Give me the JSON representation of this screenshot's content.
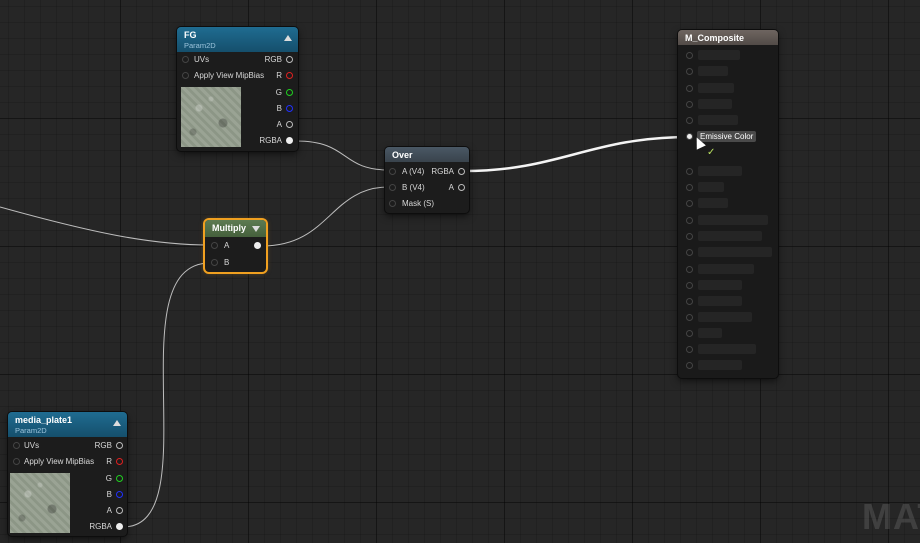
{
  "colors": {
    "param_header": "#1f6c91",
    "over_header": "#4a5865",
    "multiply_header": "#5d7b52",
    "multiply_border": "#f0a020",
    "composite_header": "#6e6560",
    "pin_red": "#e02020",
    "pin_green": "#20d020",
    "pin_blue": "#2030ff"
  },
  "fg_node": {
    "title": "FG",
    "subtitle": "Param2D",
    "inputs": [
      "UVs",
      "Apply View MipBias"
    ],
    "outputs": [
      "RGB",
      "R",
      "G",
      "B",
      "A",
      "RGBA"
    ]
  },
  "over_node": {
    "title": "Over",
    "inputs": [
      "A (V4)",
      "B (V4)",
      "Mask (S)"
    ],
    "outputs": [
      "RGBA",
      "A"
    ]
  },
  "multiply_node": {
    "title": "Multiply",
    "inputs": [
      "A",
      "B"
    ]
  },
  "media_node": {
    "title": "media_plate1",
    "subtitle": "Param2D",
    "inputs": [
      "UVs",
      "Apply View MipBias"
    ],
    "outputs": [
      "RGB",
      "R",
      "G",
      "B",
      "A",
      "RGBA"
    ]
  },
  "composite_node": {
    "title": "M_Composite",
    "highlighted_input": "Emissive Color",
    "check_mark": "✓"
  },
  "watermark": "MAT",
  "icons": {
    "collapse": "triangle-up-icon",
    "expand": "triangle-down-icon",
    "cursor": "mouse-cursor-icon"
  }
}
